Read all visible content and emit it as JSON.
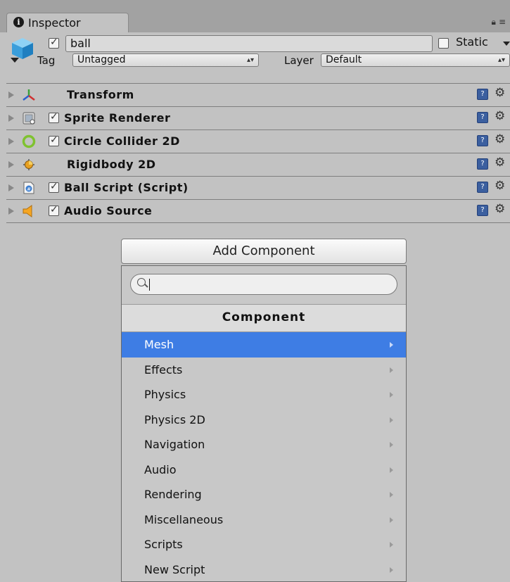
{
  "tab": {
    "label": "Inspector"
  },
  "gameobject": {
    "name": "ball",
    "active": true,
    "static_label": "Static",
    "static_checked": false,
    "tag_label": "Tag",
    "tag_value": "Untagged",
    "layer_label": "Layer",
    "layer_value": "Default"
  },
  "components": [
    {
      "name": "Transform",
      "icon": "transform-icon",
      "has_checkbox": false
    },
    {
      "name": "Sprite Renderer",
      "icon": "sprite-renderer-icon",
      "has_checkbox": true,
      "enabled": true
    },
    {
      "name": "Circle Collider 2D",
      "icon": "circle-collider-icon",
      "has_checkbox": true,
      "enabled": true
    },
    {
      "name": "Rigidbody 2D",
      "icon": "rigidbody-icon",
      "has_checkbox": false
    },
    {
      "name": "Ball Script (Script)",
      "icon": "script-icon",
      "has_checkbox": true,
      "enabled": true
    },
    {
      "name": "Audio Source",
      "icon": "audio-source-icon",
      "has_checkbox": true,
      "enabled": true
    }
  ],
  "add_component_label": "Add Component",
  "popup": {
    "search_value": "",
    "title": "Component",
    "items": [
      {
        "label": "Mesh",
        "selected": true
      },
      {
        "label": "Effects"
      },
      {
        "label": "Physics"
      },
      {
        "label": "Physics 2D"
      },
      {
        "label": "Navigation"
      },
      {
        "label": "Audio"
      },
      {
        "label": "Rendering"
      },
      {
        "label": "Miscellaneous"
      },
      {
        "label": "Scripts"
      },
      {
        "label": "New Script"
      }
    ]
  },
  "colors": {
    "selection": "#3e7de4",
    "background": "#c2c2c2"
  }
}
